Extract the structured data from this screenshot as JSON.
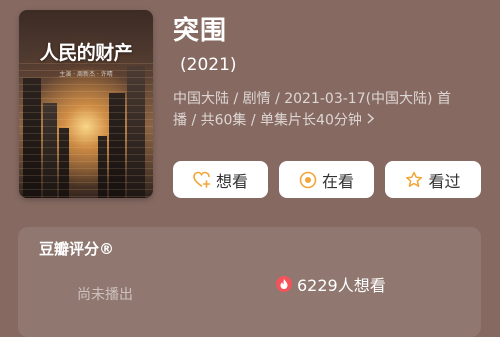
{
  "poster": {
    "title_text": "人民的财产",
    "cast_text": "主演 · 周新杰 · 许晴"
  },
  "movie": {
    "title": "突围",
    "year": "(2021)",
    "meta_line1": "中国大陆 / 剧情 / 2021-03-17(中国大陆) 首",
    "meta_line2": "播 / 共60集 / 单集片长40分钟",
    "more_icon": "chevron-right-icon"
  },
  "actions": {
    "want_label": "想看",
    "doing_label": "在看",
    "done_label": "看过",
    "want_icon": "heart-plus-icon",
    "doing_icon": "target-icon",
    "done_icon": "star-icon",
    "accent": "#f2a63a"
  },
  "rating": {
    "label": "豆瓣评分®",
    "status": "尚未播出",
    "wish_count": "6229人想看",
    "wish_icon": "fire-icon",
    "wish_icon_color": "#f4535b"
  },
  "colors": {
    "background": "#866a62"
  }
}
